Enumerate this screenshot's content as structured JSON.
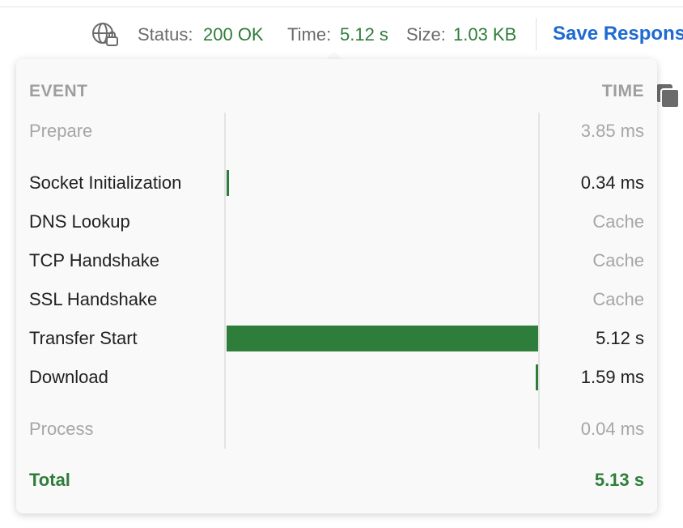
{
  "status_bar": {
    "status_label": "Status:",
    "status_value": "200 OK",
    "time_label": "Time:",
    "time_value": "5.12 s",
    "size_label": "Size:",
    "size_value": "1.03 KB",
    "save_label": "Save Response",
    "icons": [
      "globe-lock-icon",
      "copy-icon"
    ]
  },
  "timeline": {
    "header_event": "EVENT",
    "header_time": "TIME",
    "total_seconds": 5.13,
    "rows": [
      {
        "name": "Prepare",
        "time": "3.85 ms",
        "start_s": 0,
        "duration_s": 0.00385
      },
      {
        "name": "Socket Initialization",
        "time": "0.34 ms",
        "start_s": 0.00385,
        "duration_s": 0.00034
      },
      {
        "name": "DNS Lookup",
        "time": "Cache"
      },
      {
        "name": "TCP Handshake",
        "time": "Cache"
      },
      {
        "name": "SSL Handshake",
        "time": "Cache"
      },
      {
        "name": "Transfer Start",
        "time": "5.12 s",
        "start_s": 0.0042,
        "duration_s": 5.12
      },
      {
        "name": "Download",
        "time": "1.59 ms",
        "start_s": 5.1242,
        "duration_s": 0.00159
      },
      {
        "name": "Process",
        "time": "0.04 ms",
        "start_s": 5.12579,
        "duration_s": 4e-05
      }
    ],
    "total_label": "Total",
    "total_value": "5.13 s"
  },
  "colors": {
    "accent_green": "#2f7d3a",
    "link_blue": "#1f6ad1",
    "muted_text": "#a6a6a6"
  }
}
